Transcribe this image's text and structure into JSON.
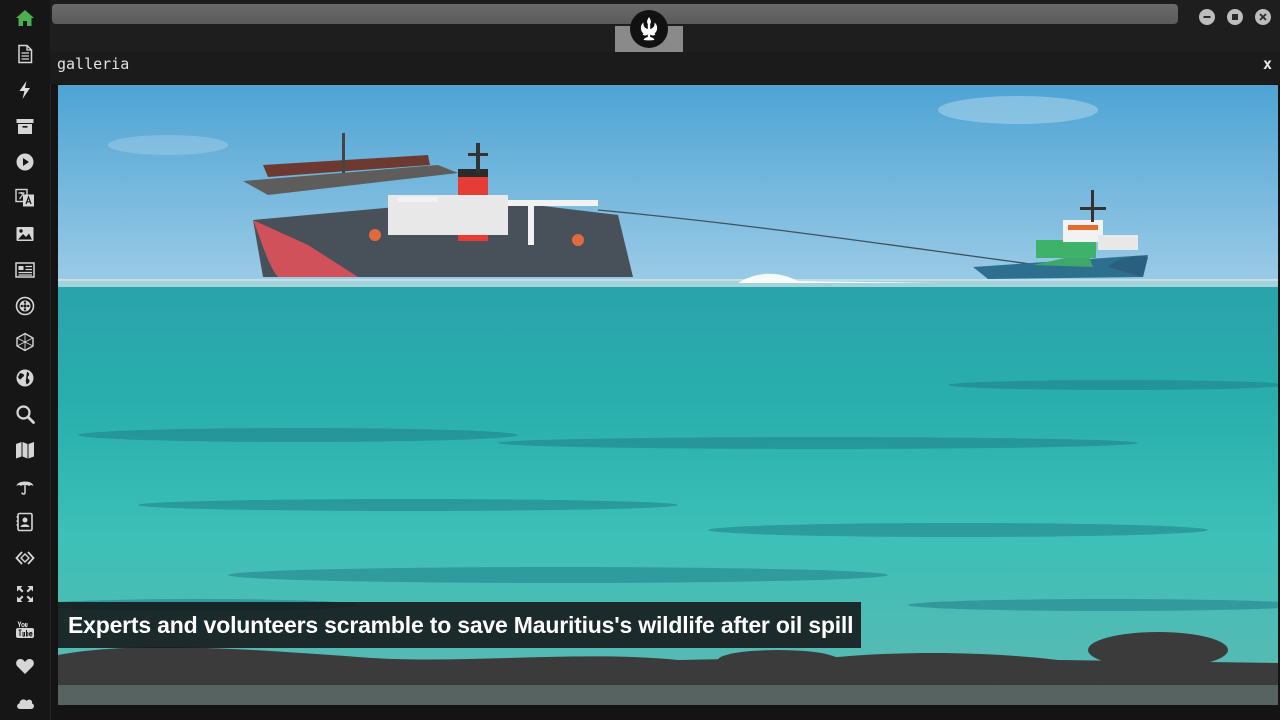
{
  "window": {
    "title": "galleria",
    "close_label": "x"
  },
  "sidebar": {
    "items": [
      {
        "icon": "home-icon",
        "color": "#4caf50"
      },
      {
        "icon": "document-icon"
      },
      {
        "icon": "lightning-icon"
      },
      {
        "icon": "archive-icon"
      },
      {
        "icon": "play-circle-icon"
      },
      {
        "icon": "translate-icon"
      },
      {
        "icon": "image-icon"
      },
      {
        "icon": "newspaper-icon"
      },
      {
        "icon": "film-reel-icon"
      },
      {
        "icon": "hexagon-icon"
      },
      {
        "icon": "globe-icon"
      },
      {
        "icon": "search-icon"
      },
      {
        "icon": "map-icon"
      },
      {
        "icon": "umbrella-icon"
      },
      {
        "icon": "contact-card-icon"
      },
      {
        "icon": "code-icon"
      },
      {
        "icon": "expand-icon"
      },
      {
        "icon": "youtube-icon"
      },
      {
        "icon": "heart-icon"
      },
      {
        "icon": "cloud-icon"
      }
    ]
  },
  "gallery": {
    "caption": "Experts and volunteers scramble to save Mauritius's wildlife after oil spill"
  },
  "colors": {
    "accent_home": "#4caf50",
    "icon": "#d6d6d6",
    "background": "#141414"
  }
}
